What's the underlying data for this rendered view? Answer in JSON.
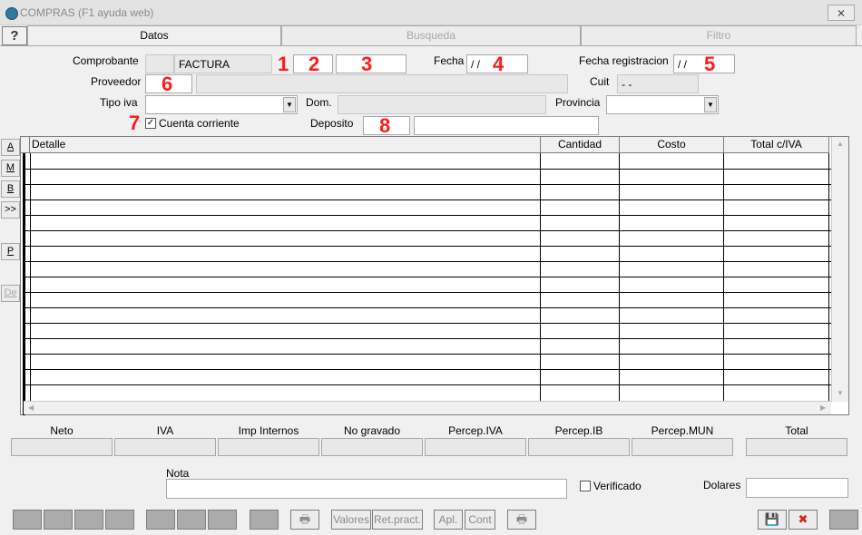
{
  "window": {
    "title": "COMPRAS (F1 ayuda web)",
    "close_label": "⨯"
  },
  "tabs": [
    {
      "label": "Datos"
    },
    {
      "label": "Busqueda"
    },
    {
      "label": "Filtro"
    }
  ],
  "help_label": "?",
  "form": {
    "comprobante_label": "Comprobante",
    "comprobante_value": "FACTURA",
    "fecha_label": "Fecha",
    "fecha_value": "/ /",
    "fecha_registracion_label": "Fecha registracion",
    "fecha_registracion_value": "/ /",
    "proveedor_label": "Proveedor",
    "cuit_label": "Cuit",
    "cuit_value": "-      -",
    "tipo_iva_label": "Tipo iva",
    "dom_label": "Dom.",
    "provincia_label": "Provincia",
    "cuenta_corriente_label": "Cuenta corriente",
    "cuenta_corriente_checked": "✓",
    "deposito_label": "Deposito"
  },
  "markers": [
    "1",
    "2",
    "3",
    "4",
    "5",
    "6",
    "7",
    "8"
  ],
  "side_buttons": [
    "A",
    "M",
    "B",
    ">>",
    "P",
    "De"
  ],
  "grid": {
    "columns": [
      "Detalle",
      "Cantidad",
      "Costo",
      "Total c/IVA"
    ],
    "arrow_up": "▲",
    "arrow_down": "▼",
    "arrow_left": "◀",
    "arrow_right": "▶"
  },
  "totals": [
    "Neto",
    "IVA",
    "Imp Internos",
    "No gravado",
    "Percep.IVA",
    "Percep.IB",
    "Percep.MUN",
    "Total"
  ],
  "nota_label": "Nota",
  "verificado_label": "Verificado",
  "dolares_label": "Dolares",
  "bottom_buttons": {
    "valores": "Valores",
    "ret_pract": "Ret.pract.",
    "apl": "Apl.",
    "cont": "Cont"
  },
  "icons": {
    "printer": "🖶",
    "save": "💾",
    "cancel": "✖"
  },
  "colors": {
    "marker": "#ff1a1a",
    "save": "#1f3f8c",
    "cancel": "#d42020"
  }
}
